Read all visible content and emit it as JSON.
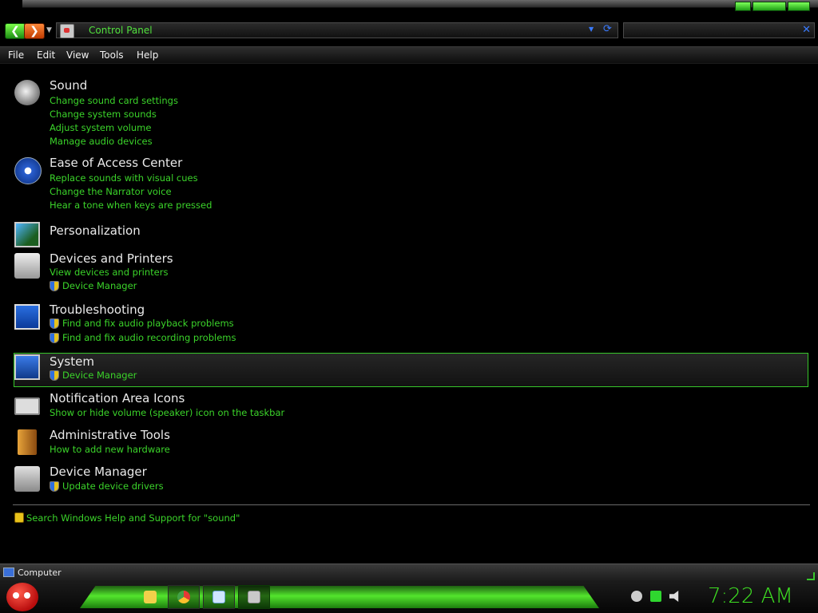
{
  "window": {
    "address": "Control Panel",
    "search_value": ""
  },
  "menu": [
    "File",
    "Edit",
    "View",
    "Tools",
    "Help"
  ],
  "groups": [
    {
      "title": "Sound",
      "icon": "speaker-icon",
      "tasks": [
        {
          "label": "Change sound card settings",
          "shield": false
        },
        {
          "label": "Change system sounds",
          "shield": false
        },
        {
          "label": "Adjust system volume",
          "shield": false
        },
        {
          "label": "Manage audio devices",
          "shield": false
        }
      ]
    },
    {
      "title": "Ease of Access Center",
      "icon": "ease-of-access-icon",
      "tasks": [
        {
          "label": "Replace sounds with visual cues",
          "shield": false
        },
        {
          "label": "Change the Narrator voice",
          "shield": false
        },
        {
          "label": "Hear a tone when keys are pressed",
          "shield": false
        }
      ]
    },
    {
      "title": "Personalization",
      "icon": "personalization-icon",
      "tasks": []
    },
    {
      "title": "Devices and Printers",
      "icon": "printer-icon",
      "tasks": [
        {
          "label": "View devices and printers",
          "shield": false
        },
        {
          "label": "Device Manager",
          "shield": true
        }
      ]
    },
    {
      "title": "Troubleshooting",
      "icon": "troubleshooting-icon",
      "tasks": [
        {
          "label": "Find and fix audio playback problems",
          "shield": true
        },
        {
          "label": "Find and fix audio recording problems",
          "shield": true
        }
      ]
    },
    {
      "title": "System",
      "icon": "system-icon",
      "tasks": [
        {
          "label": "Device Manager",
          "shield": true
        }
      ]
    },
    {
      "title": "Notification Area Icons",
      "icon": "notification-area-icon",
      "tasks": [
        {
          "label": "Show or hide volume (speaker) icon on the taskbar",
          "shield": false
        }
      ]
    },
    {
      "title": "Administrative Tools",
      "icon": "administrative-tools-icon",
      "tasks": [
        {
          "label": "How to add new hardware",
          "shield": false
        }
      ]
    },
    {
      "title": "Device Manager",
      "icon": "device-manager-icon",
      "tasks": [
        {
          "label": "Update device drivers",
          "shield": true
        }
      ]
    }
  ],
  "help_link": "Search Windows Help and Support for \"sound\"",
  "status_bar": {
    "text": "Computer"
  },
  "taskbar": {
    "clock": "7:22 AM"
  },
  "colors": {
    "accent_green": "#3bd42a",
    "address_green": "#52e23e",
    "link_blue": "#3a7bff"
  }
}
